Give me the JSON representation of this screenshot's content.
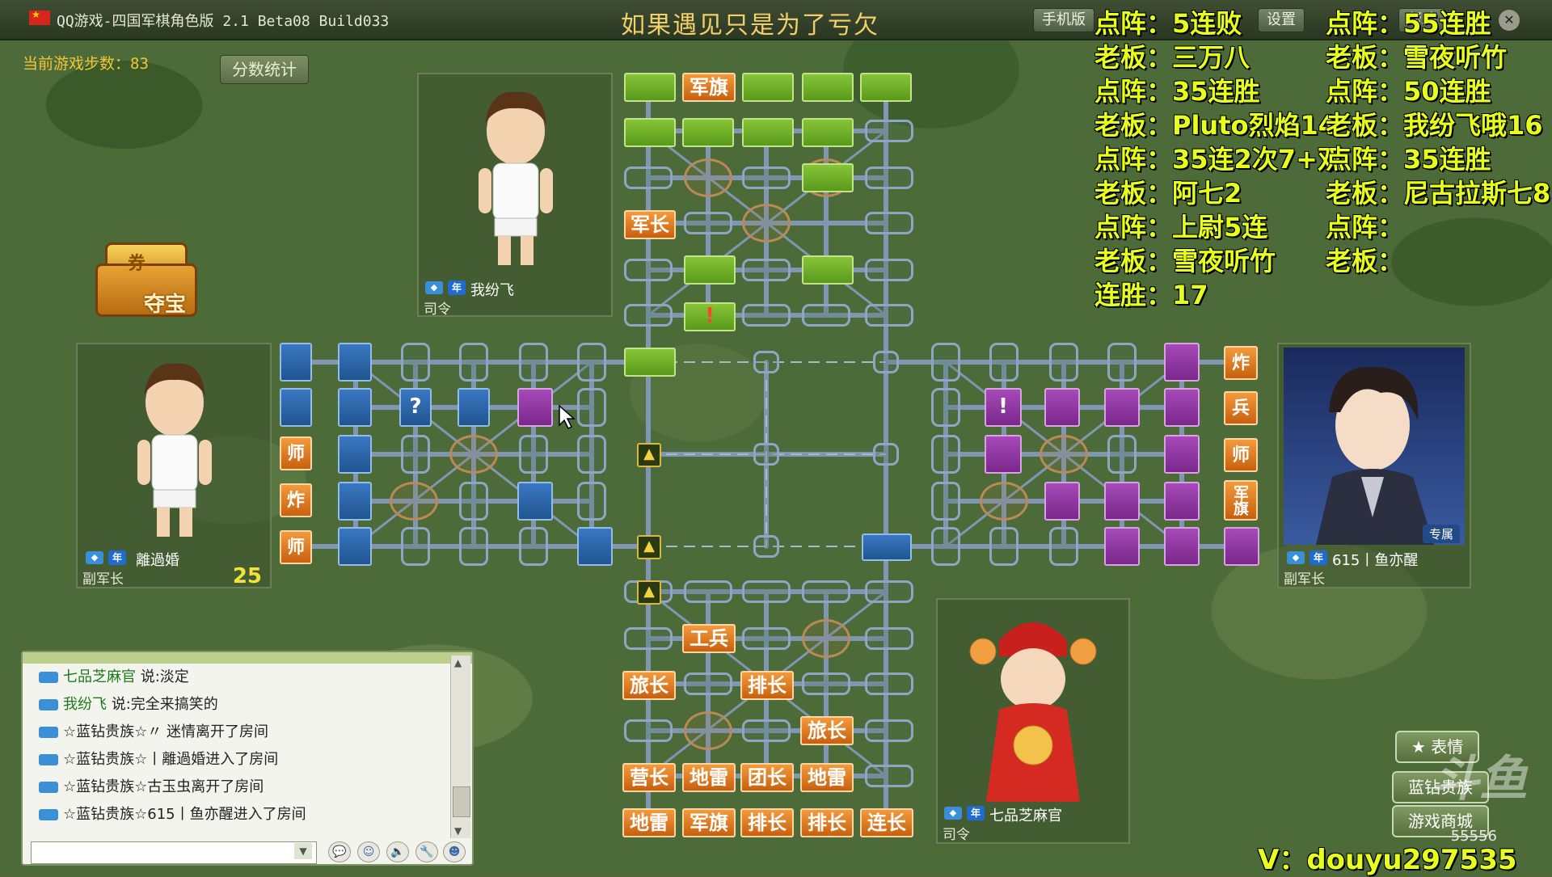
{
  "window": {
    "title": "QQ游戏-四国军棋角色版 2.1 Beta08 Build033",
    "marquee": "如果遇见只是为了亏欠",
    "buttons": [
      "手机版",
      "设置",
      "帮助"
    ]
  },
  "game": {
    "steps": "当前游戏步数：83",
    "score_button": "分数统计",
    "treasure_label": "夺宝",
    "treasure_coupon": "券"
  },
  "players": {
    "top": {
      "name": "我纷飞",
      "rank": "司令",
      "badge": "年"
    },
    "left": {
      "name": "離過婚",
      "rank": "副军长",
      "badge": "年",
      "timer": "25"
    },
    "right": {
      "name": "615丨鱼亦醒",
      "rank": "副军长",
      "badge": "年",
      "tag": "专属"
    },
    "bottom": {
      "name": "七品芝麻官",
      "rank": "司令",
      "badge": "年"
    }
  },
  "pieces": {
    "top_flag": "军旗",
    "top_army_cmdr": "军长",
    "question": "?",
    "exclaim": "!",
    "left_col": [
      "师",
      "炸",
      "师"
    ],
    "right_col": [
      "炸",
      "兵",
      "师",
      "军旗"
    ],
    "bottom_rows": [
      [
        "工兵"
      ],
      [
        "旅长",
        "排长"
      ],
      [
        "旅长"
      ],
      [
        "营长",
        "地雷",
        "团长",
        "地雷"
      ],
      [
        "地雷",
        "军旗",
        "排长",
        "排长",
        "连长"
      ]
    ]
  },
  "chat": {
    "messages": [
      {
        "who": "七品芝麻官",
        "text": "说:淡定"
      },
      {
        "who": "我纷飞",
        "text": "说:完全来搞笑的"
      },
      {
        "who": "☆蓝钻贵族☆",
        "text": "〃 迷情离开了房间"
      },
      {
        "who": "☆蓝钻贵族☆",
        "text": "丨離過婚进入了房间"
      },
      {
        "who": "☆蓝钻贵族☆",
        "text": "古玉虫离开了房间"
      },
      {
        "who": "☆蓝钻贵族☆",
        "text": "615丨鱼亦醒进入了房间"
      }
    ],
    "input_placeholder": ""
  },
  "side_buttons": [
    "表情",
    "蓝钻贵族",
    "游戏商城"
  ],
  "overlay": {
    "col1": [
      "点阵：5连败",
      "老板：三万八",
      "点阵：35连胜",
      "老板：Pluto烈焰14",
      "点阵：35连2次7+双",
      "老板：阿七2",
      "点阵：上尉5连",
      "老板：雪夜听竹",
      "连胜：17"
    ],
    "col2": [
      "点阵：55连胜",
      "老板：雪夜听竹",
      "点阵：50连胜",
      "老板：我纷飞哦16",
      "点阵：35连胜",
      "老板：尼古拉斯七8",
      "点阵：",
      "老板："
    ],
    "contact": "V：douyu297535",
    "watermark_num": "55556"
  },
  "colors": {
    "green": "#6fb12a",
    "blue": "#2d6aae",
    "purple": "#8f36a2",
    "orange": "#e27d24",
    "overlay": "#e7ff1a"
  }
}
